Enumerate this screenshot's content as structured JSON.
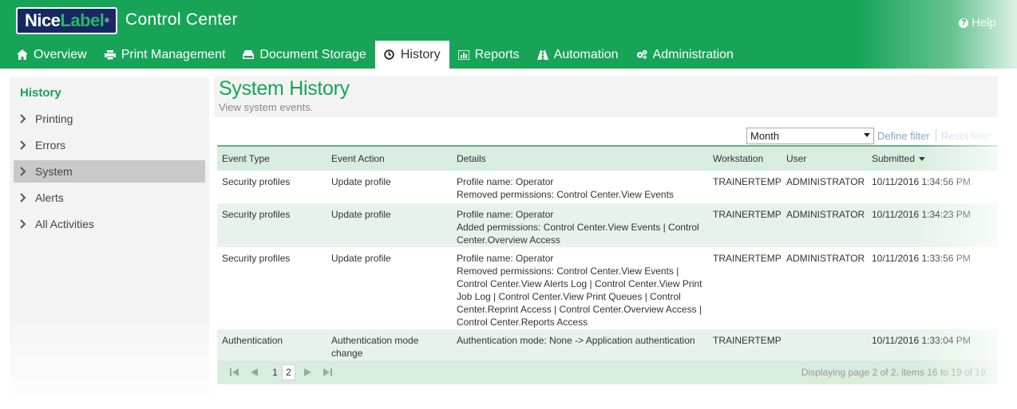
{
  "app": {
    "logo": {
      "part1": "Nice",
      "part2": "Label",
      "mark": "®"
    },
    "title": "Control Center",
    "help_label": "Help",
    "colors": {
      "brand_green": "#17a457",
      "logo_navy": "#16285f",
      "row_alt": "#e7f3ea",
      "header_row": "#d9eddf",
      "link": "#7ea9cc"
    }
  },
  "nav": {
    "items": [
      {
        "label": "Overview",
        "icon": "home-icon"
      },
      {
        "label": "Print Management",
        "icon": "printer-icon"
      },
      {
        "label": "Document Storage",
        "icon": "drive-icon"
      },
      {
        "label": "History",
        "icon": "clock-icon",
        "active": true
      },
      {
        "label": "Reports",
        "icon": "bar-chart-icon"
      },
      {
        "label": "Automation",
        "icon": "road-icon"
      },
      {
        "label": "Administration",
        "icon": "gears-icon"
      }
    ]
  },
  "sidebar": {
    "title": "History",
    "items": [
      {
        "label": "Printing"
      },
      {
        "label": "Errors"
      },
      {
        "label": "System",
        "active": true
      },
      {
        "label": "Alerts"
      },
      {
        "label": "All Activities"
      }
    ]
  },
  "page": {
    "title": "System History",
    "subtitle": "View system events."
  },
  "filter": {
    "period": "Month",
    "define_label": "Define filter",
    "reset_label": "Reset filter"
  },
  "table": {
    "columns": [
      "Event Type",
      "Event Action",
      "Details",
      "Workstation",
      "User",
      "Submitted"
    ],
    "sorted_column": "Submitted",
    "rows": [
      {
        "event_type": "Security profiles",
        "event_action": "Update profile",
        "details_lines": [
          "Profile name: Operator",
          "Removed permissions: Control Center.View Events"
        ],
        "workstation": "TRAINERTEMP",
        "user": "ADMINISTRATOR",
        "submitted": "10/11/2016 1:34:56 PM"
      },
      {
        "event_type": "Security profiles",
        "event_action": "Update profile",
        "details_lines": [
          "Profile name: Operator",
          "Added permissions: Control Center.View Events | Control",
          "Center.Overview Access"
        ],
        "workstation": "TRAINERTEMP",
        "user": "ADMINISTRATOR",
        "submitted": "10/11/2016 1:34:23 PM"
      },
      {
        "event_type": "Security profiles",
        "event_action": "Update profile",
        "details_lines": [
          "Profile name: Operator",
          "Removed permissions: Control Center.View Events |",
          "Control Center.View Alerts Log | Control Center.View Print",
          "Job Log | Control Center.View Print Queues | Control",
          "Center.Reprint Access | Control Center.Overview Access |",
          "Control Center.Reports Access"
        ],
        "workstation": "TRAINERTEMP",
        "user": "ADMINISTRATOR",
        "submitted": "10/11/2016 1:33:56 PM"
      },
      {
        "event_type": "Authentication",
        "event_action_lines": [
          "Authentication mode",
          "change"
        ],
        "details_lines": [
          "Authentication mode: None -> Application authentication"
        ],
        "workstation": "TRAINERTEMP",
        "user": "",
        "submitted": "10/11/2016 1:33:04 PM"
      }
    ]
  },
  "pager": {
    "pages": [
      "1",
      "2"
    ],
    "current_page": "2",
    "info": "Displaying page 2 of 2, items 16 to 19 of 19."
  }
}
